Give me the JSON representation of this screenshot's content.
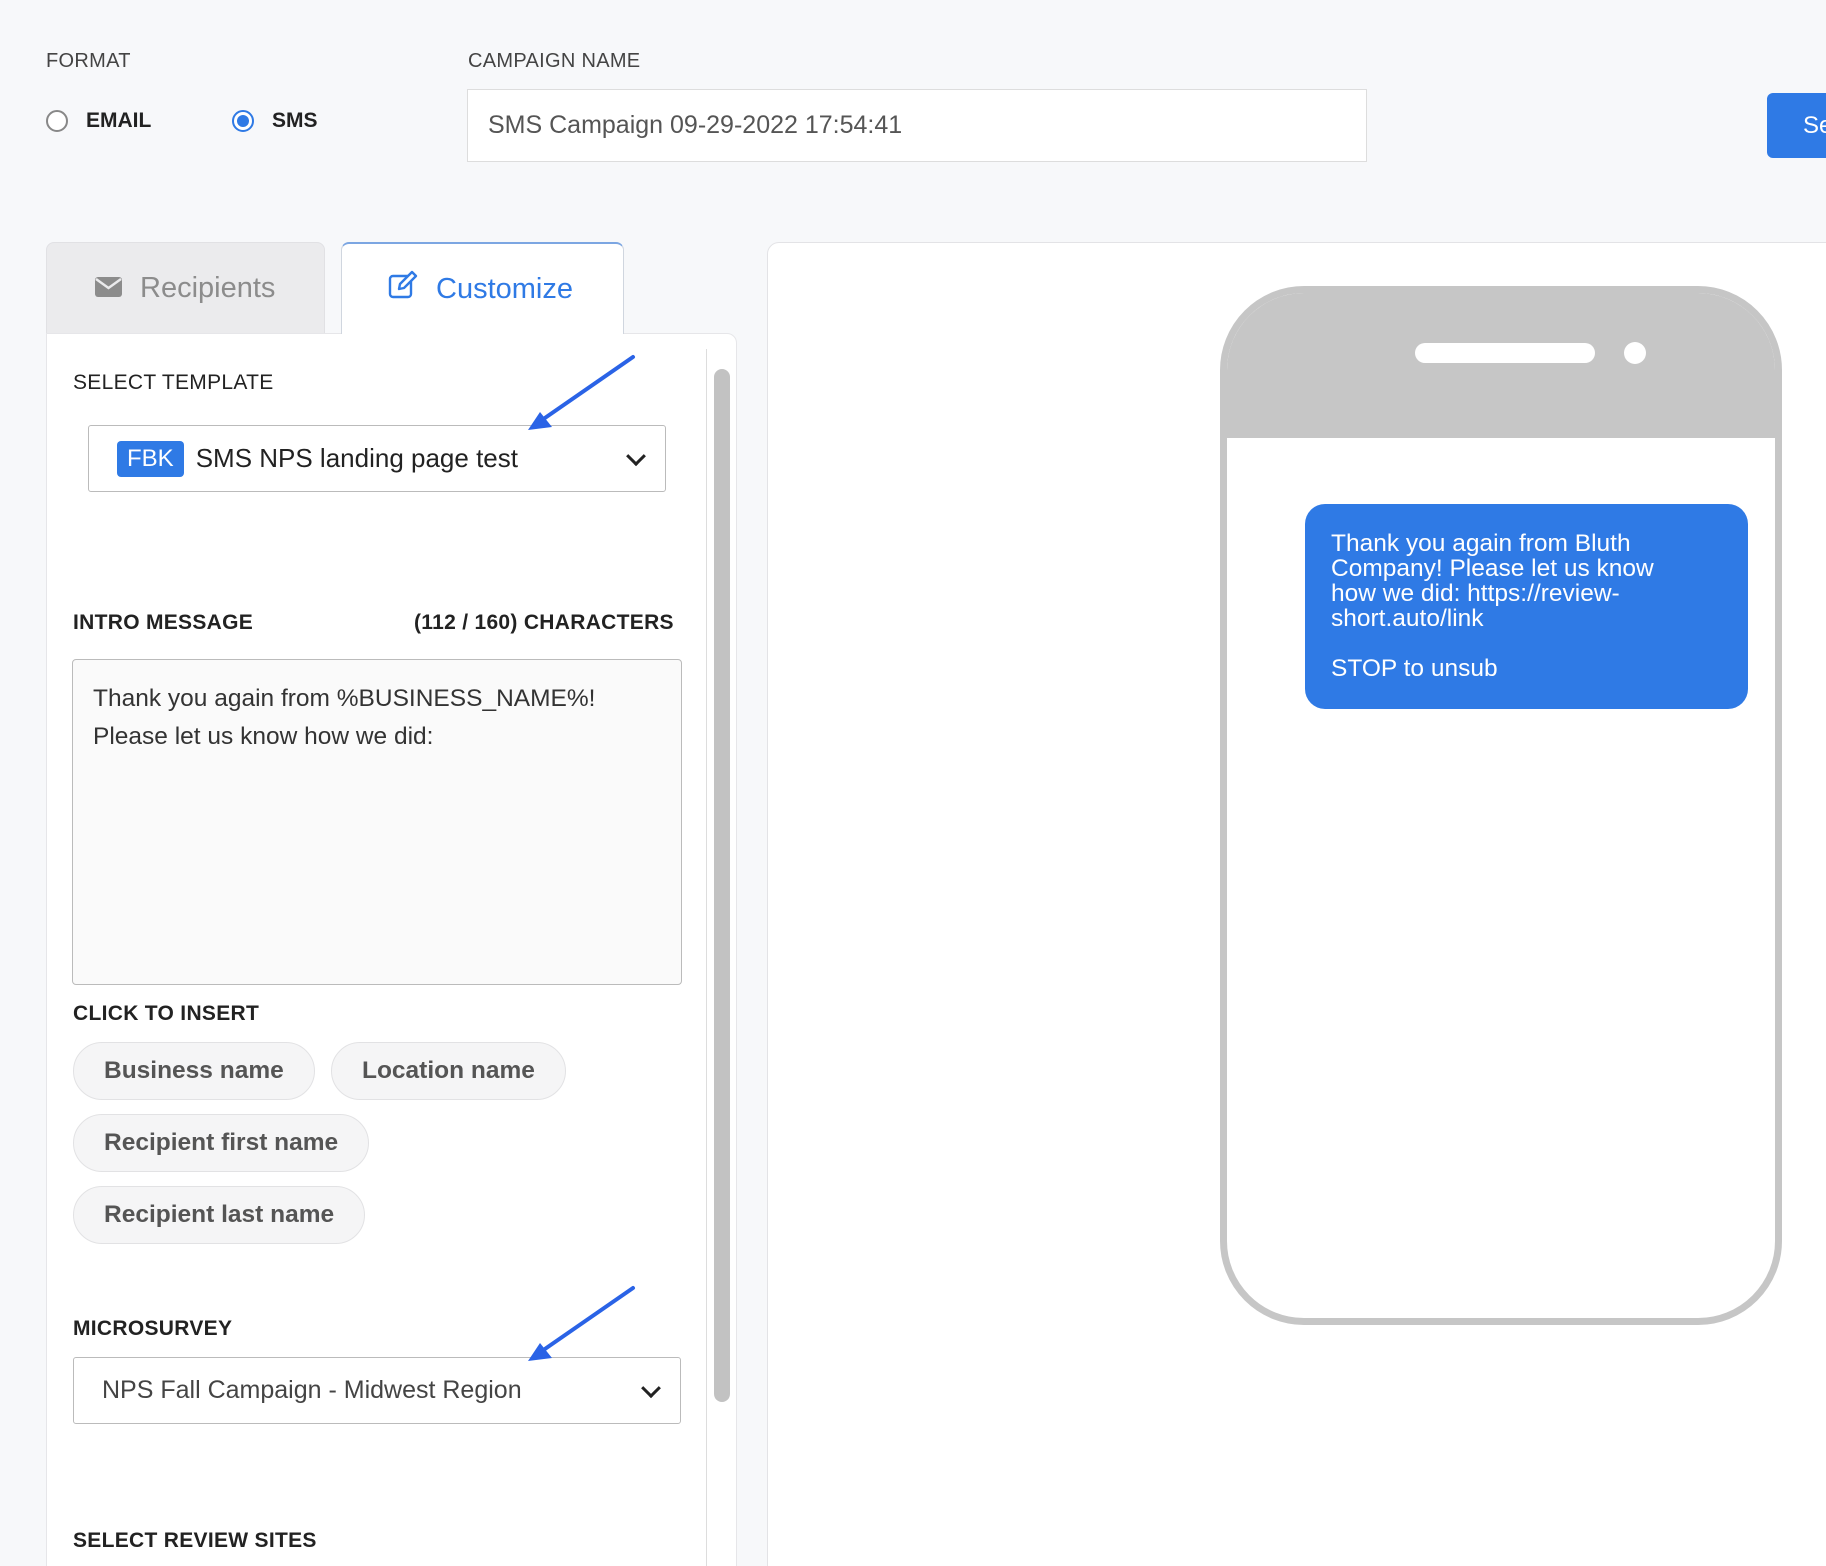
{
  "format": {
    "label": "FORMAT",
    "options": [
      {
        "label": "EMAIL",
        "selected": false
      },
      {
        "label": "SMS",
        "selected": true
      }
    ]
  },
  "campaign": {
    "label": "CAMPAIGN NAME",
    "value": "SMS Campaign 09-29-2022 17:54:41"
  },
  "send_button": {
    "label": "Se"
  },
  "tabs": [
    {
      "label": "Recipients",
      "icon": "envelope-icon",
      "active": false
    },
    {
      "label": "Customize",
      "icon": "edit-icon",
      "active": true
    }
  ],
  "template": {
    "label": "SELECT TEMPLATE",
    "badge": "FBK",
    "value": "SMS NPS landing page test"
  },
  "intro": {
    "label": "INTRO MESSAGE",
    "count": "(112 / 160) CHARACTERS",
    "text": "Thank you again from %BUSINESS_NAME%!\nPlease let us know how we did:"
  },
  "insert": {
    "label": "CLICK TO INSERT",
    "chips": [
      "Business name",
      "Location name",
      "Recipient first name",
      "Recipient last name"
    ]
  },
  "microsurvey": {
    "label": "MICROSURVEY",
    "value": "NPS Fall Campaign - Midwest Region"
  },
  "review_sites": {
    "label": "SELECT REVIEW SITES"
  },
  "preview": {
    "message": "Thank you again from Bluth\nCompany! Please let us know\nhow we did: https://review-\nshort.auto/link\n\nSTOP to unsub"
  },
  "colors": {
    "accent": "#2f7ae5",
    "annotation_arrow": "#2a63e6"
  }
}
